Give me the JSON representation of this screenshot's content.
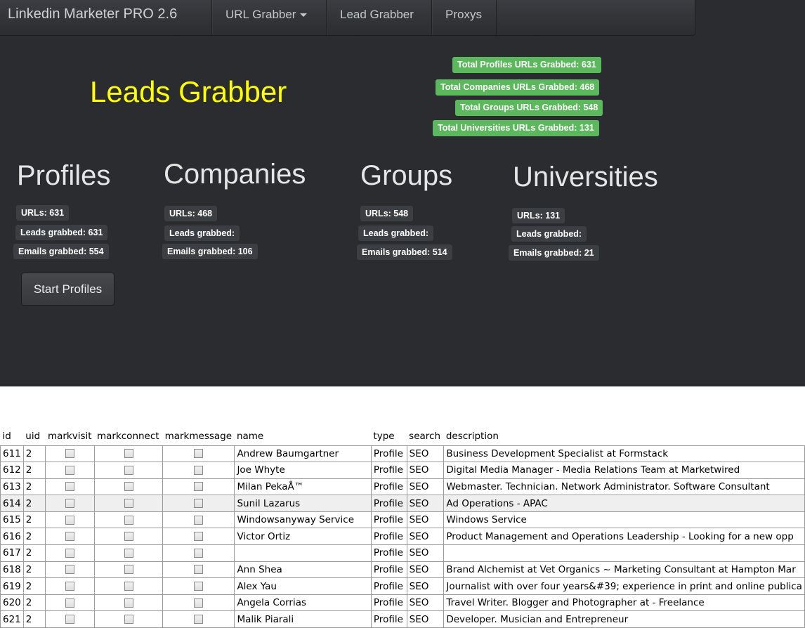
{
  "navbar": {
    "brand": "Linkedin Marketer PRO 2.6",
    "items": [
      {
        "label": "URL Grabber",
        "dropdown": true
      },
      {
        "label": "Lead Grabber"
      },
      {
        "label": "Proxys"
      }
    ]
  },
  "page_title": "Leads Grabber",
  "totals": [
    "Total Profiles URLs Grabbed: 631",
    "Total Companies URLs Grabbed: 468",
    "Total Groups URLs Grabbed: 548",
    "Total Universities URLs Grabbed: 131"
  ],
  "sections": [
    {
      "title": "Profiles",
      "urls": "URLs: 631",
      "leads": "Leads grabbed: 631",
      "emails": "Emails grabbed: 554"
    },
    {
      "title": "Companies",
      "urls": "URLs: 468",
      "leads": "Leads grabbed:",
      "emails": "Emails grabbed: 106"
    },
    {
      "title": "Groups",
      "urls": "URLs: 548",
      "leads": "Leads grabbed:",
      "emails": "Emails grabbed: 514"
    },
    {
      "title": "Universities",
      "urls": "URLs: 131",
      "leads": "Leads grabbed:",
      "emails": "Emails grabbed: 21"
    }
  ],
  "start_button": "Start Profiles",
  "colors": {
    "background": "#2a2c2f",
    "title": "#ffff00",
    "success_badge": "#5cb85c"
  },
  "table": {
    "columns": [
      "id",
      "uid",
      "markvisit",
      "markconnect",
      "markmessage",
      "name",
      "type",
      "search",
      "description"
    ],
    "rows": [
      {
        "id": "611",
        "uid": "2",
        "name": "Andrew Baumgartner",
        "type": "Profile",
        "search": "SEO",
        "description": "Business Development Specialist at Formstack"
      },
      {
        "id": "612",
        "uid": "2",
        "name": "Joe Whyte",
        "type": "Profile",
        "search": "SEO",
        "description": "Digital Media Manager - Media Relations Team at Marketwired"
      },
      {
        "id": "613",
        "uid": "2",
        "name": "Milan PekaÅ™",
        "type": "Profile",
        "search": "SEO",
        "description": "Webmaster. Technician. Network Administrator. Software Consultant"
      },
      {
        "id": "614",
        "uid": "2",
        "name": "Sunil Lazarus",
        "type": "Profile",
        "search": "SEO",
        "description": "Ad Operations - APAC",
        "highlighted": true
      },
      {
        "id": "615",
        "uid": "2",
        "name": "Windowsanyway Service",
        "type": "Profile",
        "search": "SEO",
        "description": "Windows Service"
      },
      {
        "id": "616",
        "uid": "2",
        "name": "Victor Ortiz",
        "type": "Profile",
        "search": "SEO",
        "description": "Product Management and Operations Leadership - Looking for a new opp"
      },
      {
        "id": "617",
        "uid": "2",
        "name": "",
        "type": "Profile",
        "search": "SEO",
        "description": ""
      },
      {
        "id": "618",
        "uid": "2",
        "name": "Ann Shea",
        "type": "Profile",
        "search": "SEO",
        "description": "Brand Alchemist at Vet Organics ~ Marketing Consultant at Hampton Mar"
      },
      {
        "id": "619",
        "uid": "2",
        "name": "Alex Yau",
        "type": "Profile",
        "search": "SEO",
        "description": "Journalist with over four years&#39; experience in print and online publica"
      },
      {
        "id": "620",
        "uid": "2",
        "name": "Angela Corrias",
        "type": "Profile",
        "search": "SEO",
        "description": "Travel Writer. Blogger and Photographer at - Freelance"
      },
      {
        "id": "621",
        "uid": "2",
        "name": "Malik Piarali",
        "type": "Profile",
        "search": "SEO",
        "description": "Developer. Musician and Entrepreneur"
      }
    ]
  }
}
